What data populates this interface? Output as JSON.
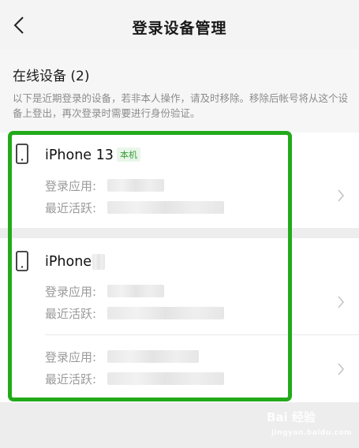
{
  "header": {
    "title": "登录设备管理",
    "back_icon": "chevron-left-icon"
  },
  "section": {
    "title": "在线设备 (2)",
    "description": "以下是近期登录的设备，若非本人操作，请及时移除。移除后帐号将从这个设备上登出，再次登录时需要进行身份验证。"
  },
  "devices": [
    {
      "name": "iPhone 13",
      "badge": "本机",
      "app_label": "登录应用:",
      "active_label": "最近活跃:"
    },
    {
      "name": "iPhone",
      "app_label": "登录应用:",
      "active_label": "最近活跃:"
    }
  ],
  "extra_session": {
    "app_label": "登录应用:",
    "active_label": "最近活跃:"
  },
  "watermark": {
    "text": "Bai 经验",
    "sub": "jingyan.baidu.com"
  },
  "colors": {
    "highlight": "#22aa1a",
    "badge": "#3a9c3a"
  }
}
